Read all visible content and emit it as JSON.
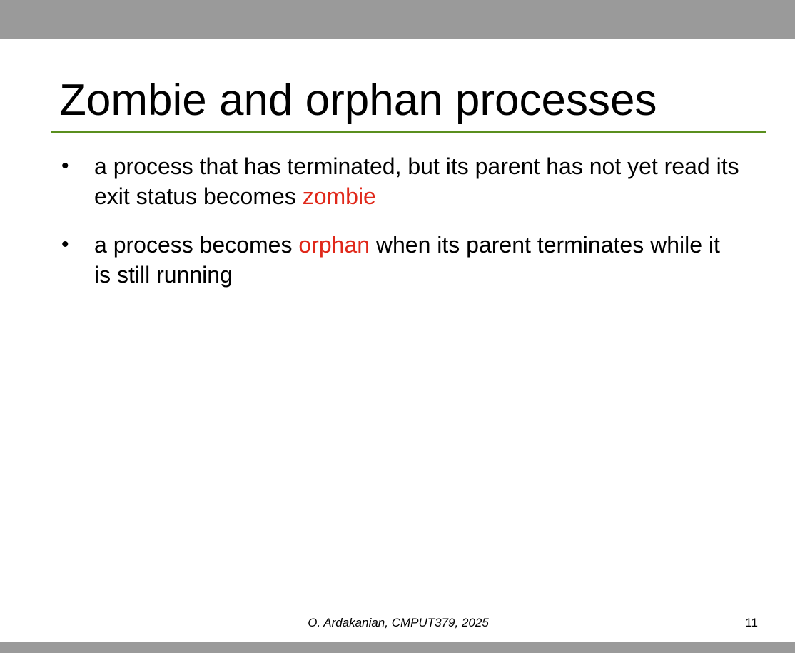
{
  "slide": {
    "title": "Zombie and orphan processes",
    "accent_color": "#5a8f1e",
    "highlight_color": "#e0281a",
    "bullets": [
      {
        "before": "a process that has terminated, but its parent has not yet read its exit status becomes ",
        "highlight": "zombie",
        "after": ""
      },
      {
        "before": "a process becomes ",
        "highlight": "orphan",
        "after": " when its parent terminates while it is still running"
      }
    ],
    "bullet_glyph": "•",
    "footer": "O. Ardakanian, CMPUT379, 2025",
    "page_number": "11"
  }
}
